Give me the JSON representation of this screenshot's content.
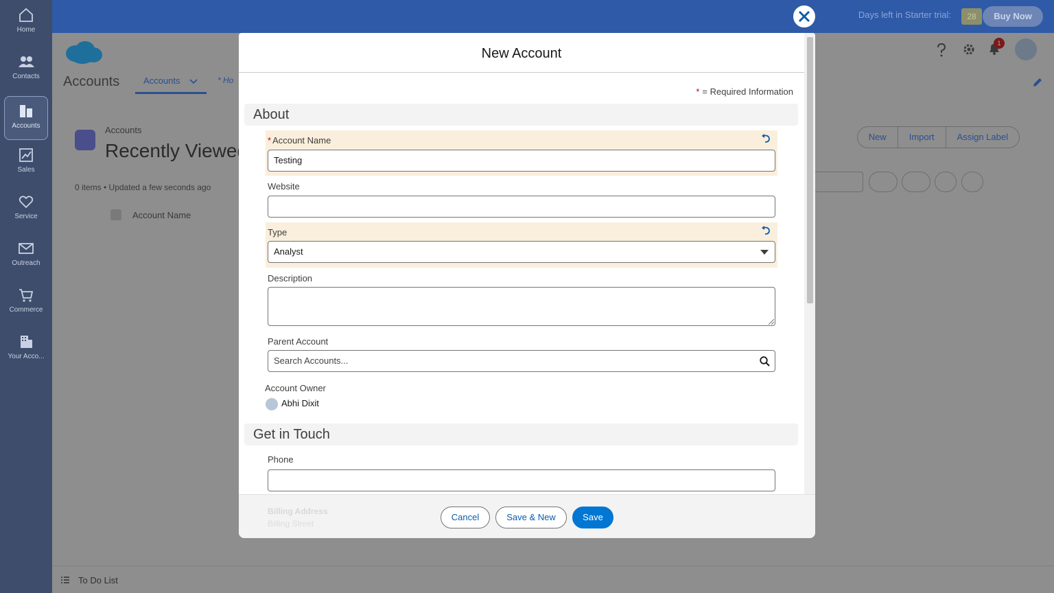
{
  "rail": {
    "items": [
      {
        "label": "Home",
        "icon": "home-icon"
      },
      {
        "label": "Contacts",
        "icon": "contacts-icon"
      },
      {
        "label": "Accounts",
        "icon": "accounts-icon"
      },
      {
        "label": "Sales",
        "icon": "sales-icon"
      },
      {
        "label": "Service",
        "icon": "heart-icon"
      },
      {
        "label": "Outreach",
        "icon": "mail-icon"
      },
      {
        "label": "Commerce",
        "icon": "cart-icon"
      },
      {
        "label": "Your Acco...",
        "icon": "building-icon"
      }
    ],
    "active": "Accounts"
  },
  "topbar": {
    "trial_text": "Days left in Starter trial:",
    "trial_days": "28",
    "buy_label": "Buy Now",
    "notification_count": "1"
  },
  "app": {
    "title": "Accounts",
    "tab_label": "Accounts",
    "tab2_label": "* Ho"
  },
  "list": {
    "breadcrumb": "Accounts",
    "title": "Recently Viewed",
    "meta": "0 items • Updated a few seconds ago",
    "column": "Account Name",
    "actions": [
      "New",
      "Import",
      "Assign Label"
    ]
  },
  "todo": {
    "label": "To Do List"
  },
  "modal": {
    "title": "New Account",
    "required_note": "= Required Information",
    "sections": {
      "about": "About",
      "contact": "Get in Touch"
    },
    "fields": {
      "account_name": {
        "label": "Account Name",
        "value": "Testing"
      },
      "website": {
        "label": "Website",
        "value": ""
      },
      "type": {
        "label": "Type",
        "value": "Analyst"
      },
      "description": {
        "label": "Description",
        "value": ""
      },
      "parent_account": {
        "label": "Parent Account",
        "placeholder": "Search Accounts..."
      },
      "account_owner": {
        "label": "Account Owner",
        "value": "Abhi Dixit"
      },
      "phone": {
        "label": "Phone",
        "value": ""
      }
    },
    "footer_ghost": {
      "heading": "Billing Address",
      "field": "Billing Street"
    },
    "buttons": {
      "cancel": "Cancel",
      "save_new": "Save & New",
      "save": "Save"
    }
  },
  "colors": {
    "brand": "#0176d3",
    "header": "#2e5aa8",
    "rail": "#3e4d6c",
    "highlight": "#faefdc",
    "required": "#ba0517"
  }
}
